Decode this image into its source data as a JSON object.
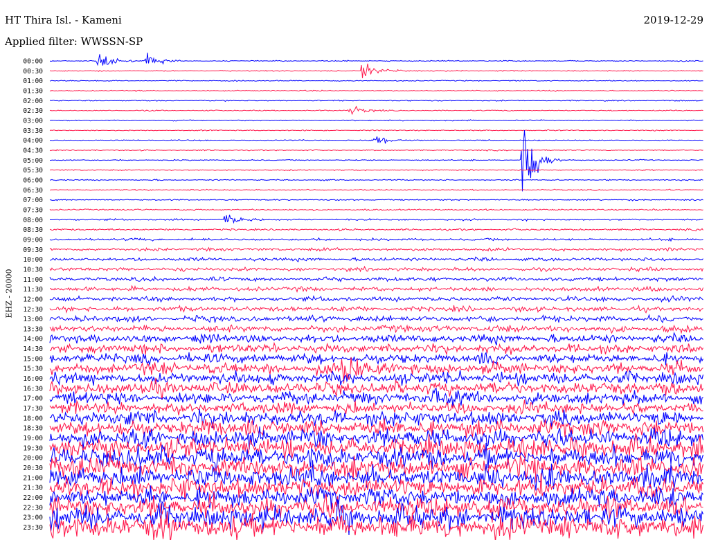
{
  "header": {
    "station": "HT Thira Isl. - Kameni",
    "date": "2019-12-29",
    "filter": "Applied filter: WWSSN-SP"
  },
  "chart_data": {
    "type": "line",
    "title": "HT Thira Isl. - Kameni",
    "ylabel": "EHZ - 20000",
    "colors": [
      "#0000ff",
      "#ff1a4d"
    ],
    "time_labels": [
      "00:00",
      "00:30",
      "01:00",
      "01:30",
      "02:00",
      "02:30",
      "03:00",
      "03:30",
      "04:00",
      "04:30",
      "05:00",
      "05:30",
      "06:00",
      "06:30",
      "07:00",
      "07:30",
      "08:00",
      "08:30",
      "09:00",
      "09:30",
      "10:00",
      "10:30",
      "11:00",
      "11:30",
      "12:00",
      "12:30",
      "13:00",
      "13:30",
      "14:00",
      "14:30",
      "15:00",
      "15:30",
      "16:00",
      "16:30",
      "17:00",
      "17:30",
      "18:00",
      "18:30",
      "19:00",
      "19:30",
      "20:00",
      "20:30",
      "21:00",
      "21:30",
      "22:00",
      "22:30",
      "23:00",
      "23:30"
    ],
    "noise_level": [
      0.15,
      0.15,
      0.15,
      0.16,
      0.16,
      0.16,
      0.17,
      0.16,
      0.16,
      0.16,
      0.17,
      0.17,
      0.18,
      0.18,
      0.2,
      0.22,
      0.25,
      0.28,
      0.35,
      0.45,
      0.5,
      0.55,
      0.6,
      0.65,
      0.7,
      0.75,
      0.9,
      1.0,
      1.2,
      1.3,
      1.45,
      1.6,
      1.7,
      1.8,
      1.75,
      1.7,
      2.2,
      2.5,
      2.6,
      2.8,
      3.0,
      3.0,
      3.1,
      3.0,
      2.9,
      3.0,
      3.2,
      3.5
    ],
    "events": [
      {
        "trace": 0,
        "t": 0.075,
        "amp": 1.0
      },
      {
        "trace": 0,
        "t": 0.15,
        "amp": 0.8
      },
      {
        "trace": 1,
        "t": 0.48,
        "amp": 1.2
      },
      {
        "trace": 5,
        "t": 0.46,
        "amp": 0.6
      },
      {
        "trace": 8,
        "t": 0.5,
        "amp": 0.7
      },
      {
        "trace": 10,
        "t": 0.725,
        "amp": 5.0
      },
      {
        "trace": 16,
        "t": 0.27,
        "amp": 0.8
      },
      {
        "trace": 31,
        "t": 0.45,
        "amp": 3.0
      },
      {
        "trace": 34,
        "t": 0.59,
        "amp": 1.5
      }
    ]
  }
}
